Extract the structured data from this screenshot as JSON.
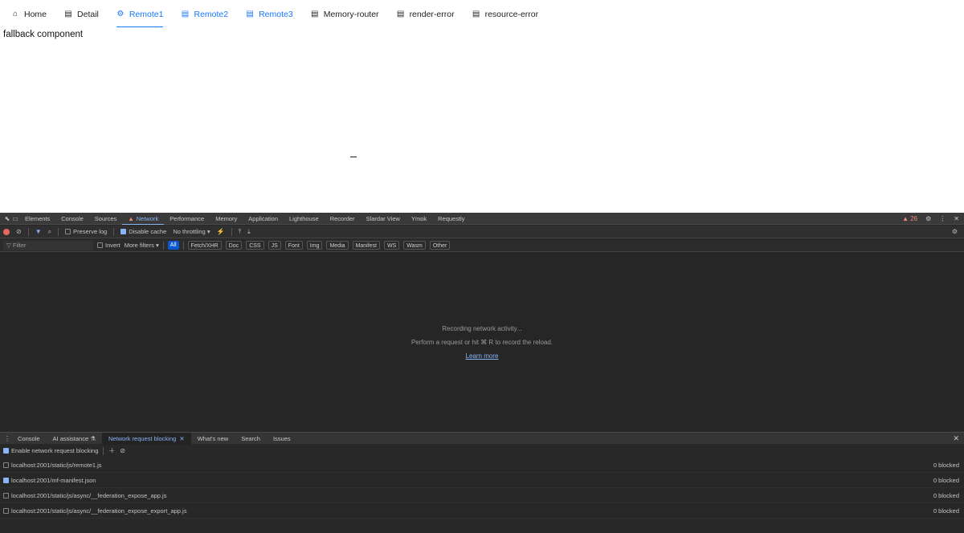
{
  "nav": {
    "items": [
      {
        "label": "Home",
        "icon": "home-icon",
        "glyph": "⌂"
      },
      {
        "label": "Detail",
        "icon": "list-icon",
        "glyph": "▤"
      },
      {
        "label": "Remote1",
        "icon": "settings-icon",
        "glyph": "⚙"
      },
      {
        "label": "Remote2",
        "icon": "list-icon",
        "glyph": "▤"
      },
      {
        "label": "Remote3",
        "icon": "list-icon",
        "glyph": "▤"
      },
      {
        "label": "Memory-router",
        "icon": "list-icon",
        "glyph": "▤"
      },
      {
        "label": "render-error",
        "icon": "list-icon",
        "glyph": "▤"
      },
      {
        "label": "resource-error",
        "icon": "list-icon",
        "glyph": "▤"
      }
    ],
    "active": "Remote1"
  },
  "main": {
    "fallback_text": "fallback component"
  },
  "devtools": {
    "tabs": [
      "Elements",
      "Console",
      "Sources",
      "Network",
      "Performance",
      "Memory",
      "Application",
      "Lighthouse",
      "Recorder",
      "Slardar View",
      "Ymok",
      "Requestly"
    ],
    "active_tab": "Network",
    "issues_count": "26",
    "toolbar": {
      "preserve_log": "Preserve log",
      "disable_cache": "Disable cache",
      "throttling": "No throttling"
    },
    "filter": {
      "placeholder": "Filter",
      "invert": "Invert",
      "more_filters": "More filters",
      "types": [
        "All",
        "Fetch/XHR",
        "Doc",
        "CSS",
        "JS",
        "Font",
        "Img",
        "Media",
        "Manifest",
        "WS",
        "Wasm",
        "Other"
      ]
    },
    "empty": {
      "line1": "Recording network activity...",
      "line2": "Perform a request or hit ⌘ R to record the reload.",
      "learn_more": "Learn more"
    },
    "drawer": {
      "tabs": [
        "Console",
        "AI assistance",
        "Network request blocking",
        "What's new",
        "Search",
        "Issues"
      ],
      "active_tab": "Network request blocking",
      "enable_label": "Enable network request blocking",
      "patterns": [
        {
          "url": "localhost:2001/static/js/remote1.js",
          "checked": false,
          "count": "0 blocked"
        },
        {
          "url": "localhost:2001/mf-manifest.json",
          "checked": true,
          "count": "0 blocked"
        },
        {
          "url": "localhost:2001/static/js/async/__federation_expose_app.js",
          "checked": false,
          "count": "0 blocked"
        },
        {
          "url": "localhost:2001/static/js/async/__federation_expose_export_app.js",
          "checked": false,
          "count": "0 blocked"
        }
      ]
    },
    "colors": {
      "accent": "#8ab4f8",
      "panel_bg": "#282828",
      "app_link": "#1677ff"
    }
  }
}
